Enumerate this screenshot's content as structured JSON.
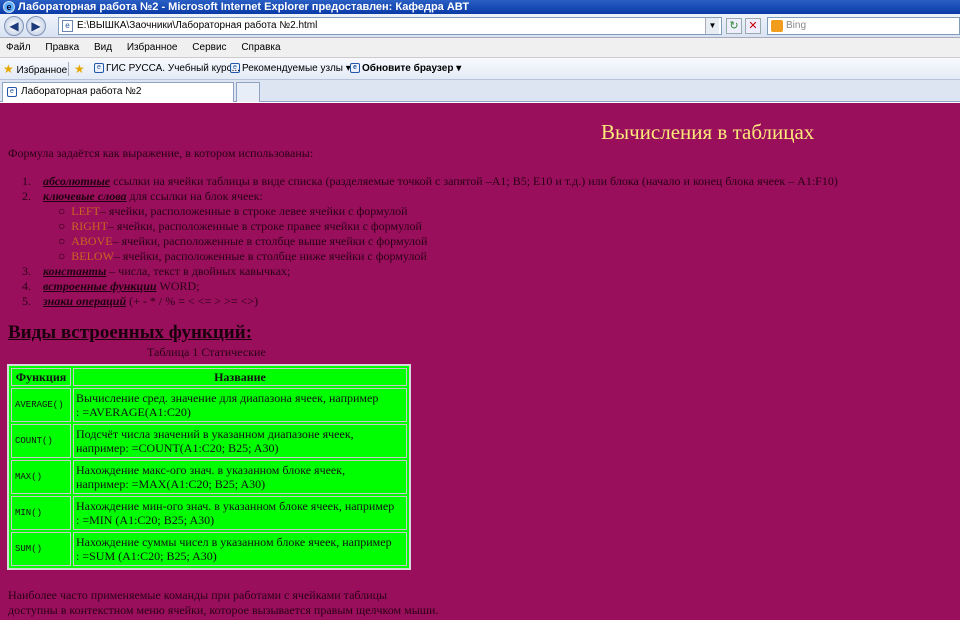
{
  "window": {
    "title": "Лабораторная работа №2 - Microsoft Internet Explorer предоставлен: Кафедра АВТ"
  },
  "address": {
    "url": "E:\\ВЫШКА\\Заочники\\Лабораторная работа №2.html",
    "search_placeholder": "Bing"
  },
  "menu": {
    "items": [
      "Файл",
      "Правка",
      "Вид",
      "Избранное",
      "Сервис",
      "Справка"
    ]
  },
  "favorites": {
    "label": "Избранное",
    "links": [
      "ГИС РУССА. Учебный курс...",
      "Рекомендуемые узлы",
      "Обновите браузер"
    ]
  },
  "tab": {
    "label": "Лабораторная работа №2"
  },
  "page": {
    "heading": "Вычисления в таблицах",
    "intro": "Формула задаётся как выражение, в котором использованы:",
    "items": [
      {
        "num": "1.",
        "term": "абсолютные",
        "text": " ссылки на ячейки таблицы в виде списка (разделяемые точкой с запятой –A1; B5; E10 и т.д.) или блока (начало и конец блока ячеек – A1:F10)"
      },
      {
        "num": "2.",
        "term": "ключевые слова",
        "text": " для ссылки на блок ячеек:"
      },
      {
        "num": "3.",
        "term": "константы",
        "text": " – числа, текст в двойных кавычках;"
      },
      {
        "num": "4.",
        "term": "встроенные функции",
        "text": " WORD;"
      },
      {
        "num": "5.",
        "term": "знаки операций",
        "text": " (+ - * / % = < <= > >= <>)"
      }
    ],
    "keywords": [
      {
        "kw": "LEFT",
        "text": "– ячейки, расположенные в строке левее ячейки с формулой"
      },
      {
        "kw": "RIGHT",
        "text": "– ячейки, расположенные в строке правее ячейки с формулой"
      },
      {
        "kw": "ABOVE",
        "text": "– ячейки, расположенные в столбце выше ячейки с формулой"
      },
      {
        "kw": "BELOW",
        "text": "– ячейки, расположенные в столбце ниже ячейки с формулой"
      }
    ],
    "section_title": "Виды встроенных функций:",
    "table_caption": "Таблица 1 Статические",
    "table": {
      "headers": [
        "Функция",
        "Название"
      ],
      "rows": [
        {
          "fn": "AVERAGE()",
          "desc1": "Вычисление сред. значение для диапазона ячеек, например",
          "desc2": ": =AVERAGE(A1:C20)"
        },
        {
          "fn": "COUNT()",
          "desc1": "Подсчёт числа значений в указанном диапазоне ячеек,",
          "desc2": "например: =COUNT(A1:C20; B25; A30)"
        },
        {
          "fn": "MAX()",
          "desc1": "Нахождение макс-ого знач. в указанном блоке ячеек,",
          "desc2": "например: =MAX(A1:C20; B25; A30)"
        },
        {
          "fn": "MIN()",
          "desc1": "Нахождение мин-ого знач. в указанном блоке ячеек, например",
          "desc2": ": =MIN (A1:C20; B25; A30)"
        },
        {
          "fn": "SUM()",
          "desc1": "Нахождение суммы чисел в указанном блоке ячеек, например",
          "desc2": ": =SUM (A1:C20; B25; A30)"
        }
      ]
    },
    "footer": [
      "Наиболее часто применяемые команды при работами с ячейками таблицы",
      "доступны в контекстном меню ячейки, которое вызывается правым щелчком мыши."
    ]
  },
  "colors": {
    "page_bg": "#990f5c",
    "heading": "#ffe97a",
    "table_bg": "#00ff00",
    "keyword": "#c9651f"
  }
}
